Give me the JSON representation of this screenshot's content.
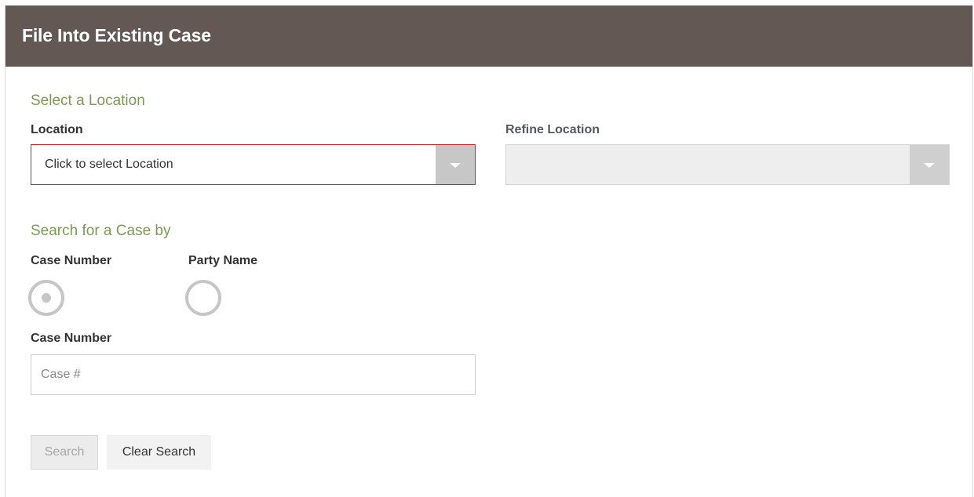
{
  "header": {
    "title": "File Into Existing Case",
    "background_color": "#635854"
  },
  "location_section": {
    "heading": "Select a Location",
    "location_label": "Location",
    "location_select_value": "Click to select Location",
    "location_select_state": "invalid",
    "refine_label": "Refine Location",
    "refine_select_value": "",
    "refine_select_state": "disabled"
  },
  "search_section": {
    "heading": "Search for a Case by",
    "options": [
      {
        "label": "Case Number",
        "selected": true
      },
      {
        "label": "Party Name",
        "selected": false
      }
    ],
    "case_number_label": "Case Number",
    "case_number_placeholder": "Case #",
    "case_number_value": ""
  },
  "buttons": {
    "search_label": "Search",
    "search_enabled": false,
    "clear_label": "Clear Search"
  },
  "colors": {
    "accent_heading": "#7c9a54",
    "error_border": "#c0282c"
  },
  "icons": {
    "dropdown": "chevron-down-icon",
    "radio_on": "radio-selected-icon",
    "radio_off": "radio-unselected-icon"
  }
}
